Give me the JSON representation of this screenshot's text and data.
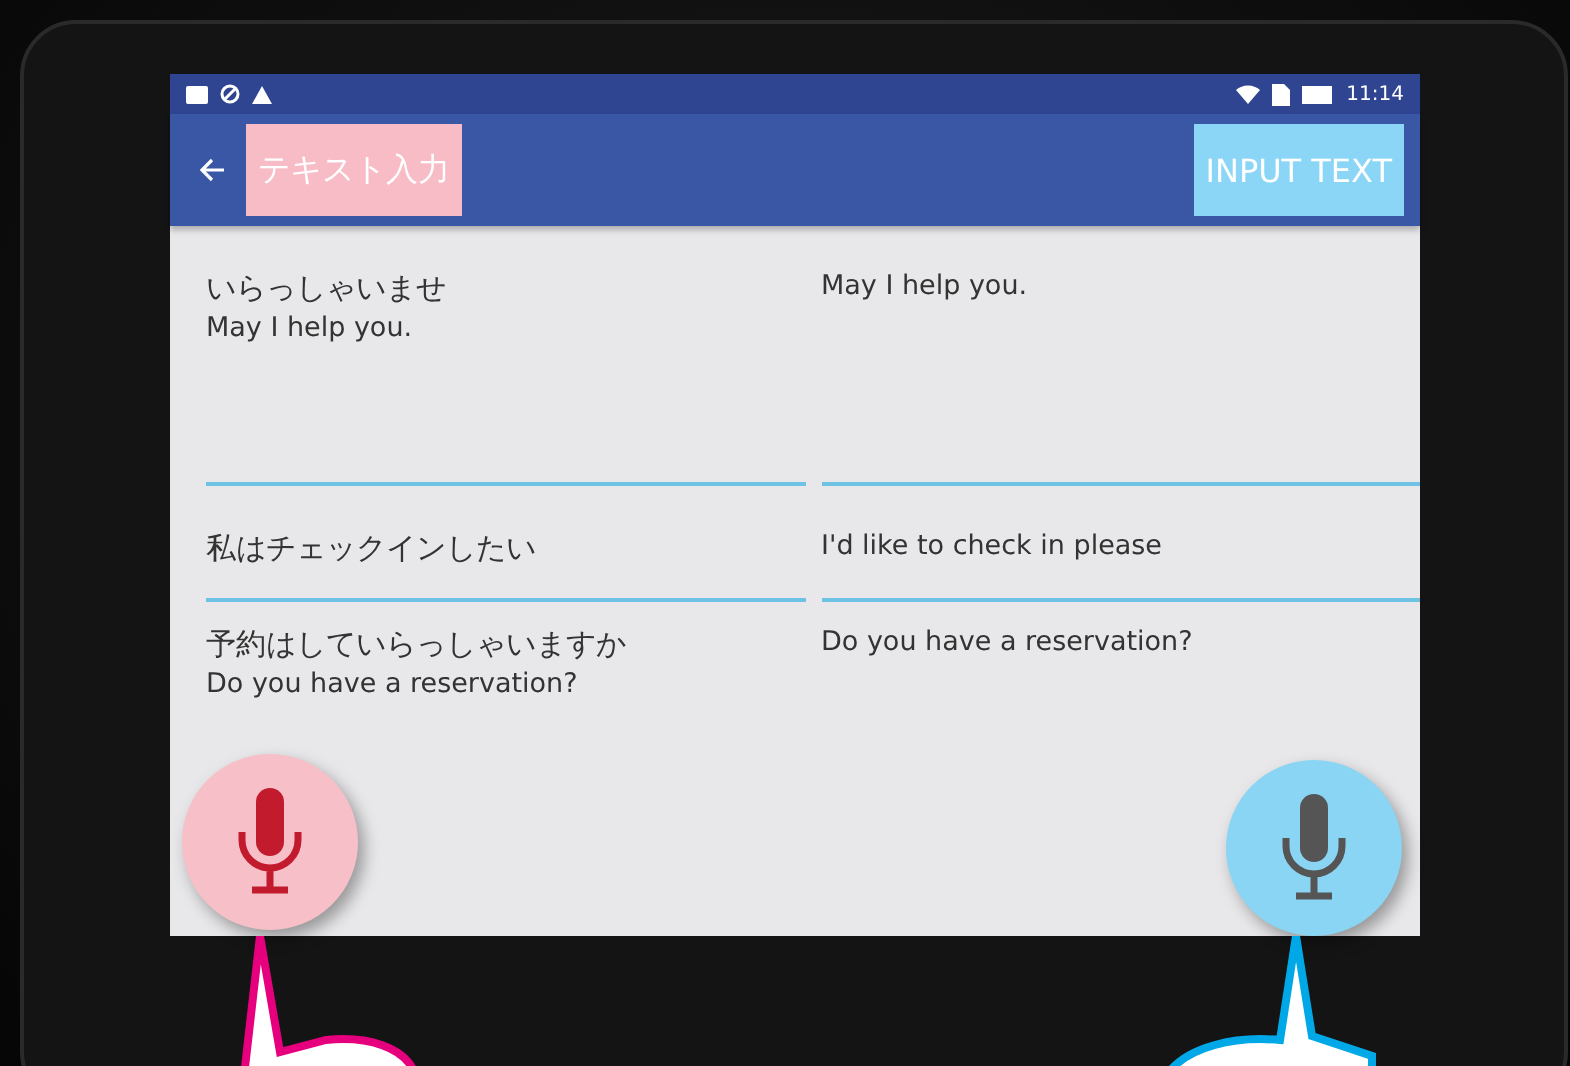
{
  "status_bar": {
    "time": "11:14"
  },
  "app_bar": {
    "left_title": "テキスト入力",
    "right_title": "INPUT TEXT"
  },
  "rows": [
    {
      "source": "いらっしゃいませ",
      "source_translation": "May I help you.",
      "target": "May I help you."
    },
    {
      "source": "私はチェックインしたい",
      "target": "I'd like to check in please"
    },
    {
      "source": "予約はしていらっしゃいますか",
      "source_translation": "Do you have a reservation?",
      "target": "Do you have a reservation?"
    }
  ]
}
